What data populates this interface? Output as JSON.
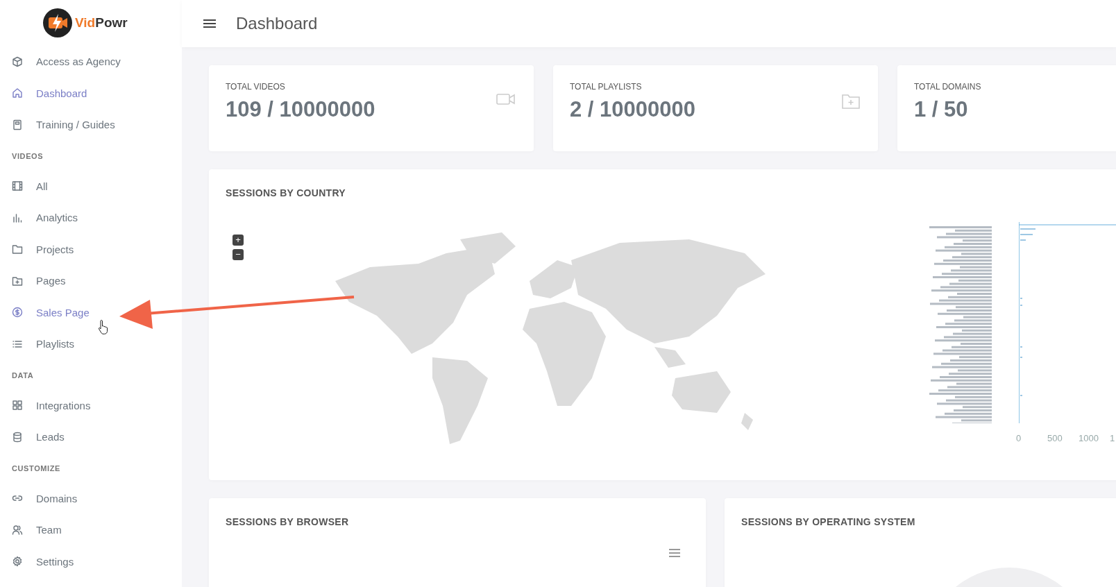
{
  "sidebar": {
    "brand": {
      "first": "Vid",
      "second": "Powr"
    },
    "groups": [
      {
        "items": [
          {
            "label": "Access as Agency",
            "selected": false
          },
          {
            "label": "Dashboard",
            "selected": true
          },
          {
            "label": "Training / Guides",
            "selected": false
          }
        ]
      },
      {
        "heading": "VIDEOS",
        "items": [
          {
            "label": "All",
            "selected": false
          },
          {
            "label": "Analytics",
            "selected": false
          },
          {
            "label": "Projects",
            "selected": false
          },
          {
            "label": "Pages",
            "selected": false
          },
          {
            "label": "Sales Page",
            "selected": true
          },
          {
            "label": "Playlists",
            "selected": false
          }
        ]
      },
      {
        "heading": "DATA",
        "items": [
          {
            "label": "Integrations",
            "selected": false
          },
          {
            "label": "Leads",
            "selected": false
          }
        ]
      },
      {
        "heading": "CUSTOMIZE",
        "items": [
          {
            "label": "Domains",
            "selected": false
          },
          {
            "label": "Team",
            "selected": false
          },
          {
            "label": "Settings",
            "selected": false
          }
        ]
      }
    ]
  },
  "header": {
    "title": "Dashboard"
  },
  "stats": [
    {
      "label": "TOTAL VIDEOS",
      "value": "109 / 10000000"
    },
    {
      "label": "TOTAL PLAYLISTS",
      "value": "2 / 10000000"
    },
    {
      "label": "TOTAL DOMAINS",
      "value": "1 / 50"
    }
  ],
  "country_panel": {
    "title": "SESSIONS BY COUNTRY",
    "zoom_in": "+",
    "zoom_out": "−",
    "x_ticks": [
      "0",
      "500",
      "1000",
      "1"
    ]
  },
  "bottom_panels": [
    {
      "title": "SESSIONS BY BROWSER"
    },
    {
      "title": "SESSIONS BY OPERATING SYSTEM"
    }
  ]
}
